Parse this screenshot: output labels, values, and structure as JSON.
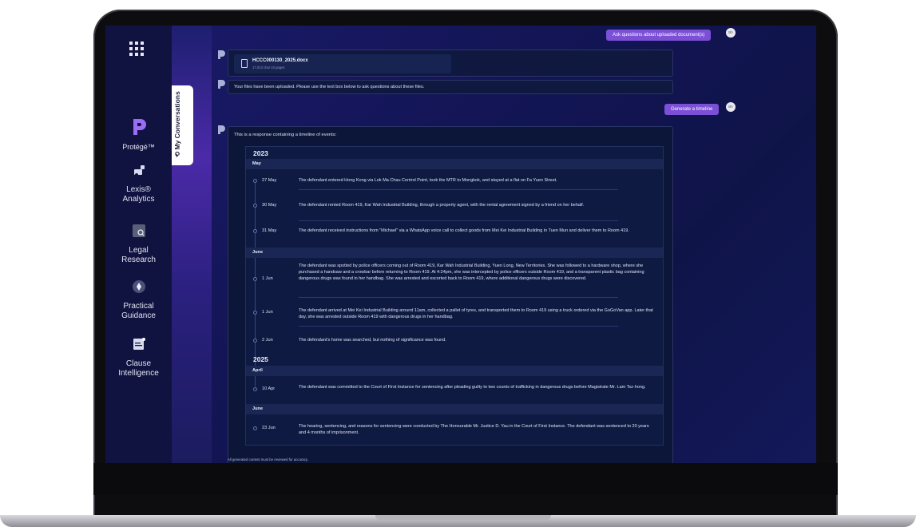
{
  "nav": {
    "brand_name": "Protégé™",
    "items": [
      {
        "label_line1": "Lexis®",
        "label_line2": "Analytics",
        "icon": "analytics-icon"
      },
      {
        "label_line1": "Legal",
        "label_line2": "Research",
        "icon": "research-icon"
      },
      {
        "label_line1": "Practical",
        "label_line2": "Guidance",
        "icon": "guidance-icon"
      },
      {
        "label_line1": "Clause",
        "label_line2": "Intelligence",
        "icon": "clause-icon"
      }
    ]
  },
  "conversations_tab": {
    "label": "My Conversations"
  },
  "chat": {
    "user_avatar_initials": "Bh",
    "user_message_1": "Ask questions about uploaded document(s)",
    "file": {
      "name": "HCCC000130_2025.docx",
      "meta": "17,013 char 10 pages"
    },
    "upload_confirmation": "Your files have been uploaded. Please use the text box below to ask questions about these files.",
    "user_message_2": "Generate a timeline",
    "timeline_intro": "This is a response containing a timeline of events:",
    "disclaimer": "All generated content must be reviewed for accuracy."
  },
  "timeline": {
    "year_2023": "2023",
    "year_2025": "2025",
    "month_may": "May",
    "month_june_2023": "June",
    "month_april": "April",
    "month_june_2025": "June",
    "events": [
      {
        "date": "27 May",
        "text": "The defendant entered Hong Kong via Lok Ma Chau Control Point, took the MTR to Mongkok, and stayed at a flat on Fa Yuen Street."
      },
      {
        "date": "30 May",
        "text": "The defendant rented Room 419, Kar Wah Industrial Building, through a property agent, with the rental agreement signed by a friend on her behalf."
      },
      {
        "date": "31 May",
        "text": "The defendant received instructions from \"Michael\" via a WhatsApp voice call to collect goods from Mei Kei Industrial Building in Tuen Mun and deliver them to Room 419."
      },
      {
        "date": "1 Jun",
        "text": "The defendant was spotted by police officers coming out of Room 419, Kar Wah Industrial Building, Yuen Long, New Territories. She was followed to a hardware shop, where she purchased a handsaw and a crowbar before returning to Room 419. At 4:24pm, she was intercepted by police officers outside Room 419, and a transparent plastic bag containing dangerous drugs was found in her handbag. She was arrested and escorted back to Room 419, where additional dangerous drugs were discovered."
      },
      {
        "date": "1 Jun",
        "text": "The defendant arrived at Mei Kei Industrial Building around 11am, collected a pallet of tyres, and transported them to Room 419 using a truck ordered via the GoGoVan app. Later that day, she was arrested outside Room 419 with dangerous drugs in her handbag."
      },
      {
        "date": "2 Jun",
        "text": "The defendant's home was searched, but nothing of significance was found."
      },
      {
        "date": "10 Apr",
        "text": "The defendant was committed to the Court of First Instance for sentencing after pleading guilty to two counts of trafficking in dangerous drugs before Magistrate Mr. Lam Tsz-hong."
      },
      {
        "date": "23 Jun",
        "text": "The hearing, sentencing, and reasons for sentencing were conducted by The Honourable Mr. Justice D. Yau in the Court of First Instance. The defendant was sentenced to 20 years and 4 months of imprisonment."
      }
    ]
  },
  "colors": {
    "accent": "#7b4fd6",
    "brand": "#8f5cf0",
    "background": "#131556"
  }
}
